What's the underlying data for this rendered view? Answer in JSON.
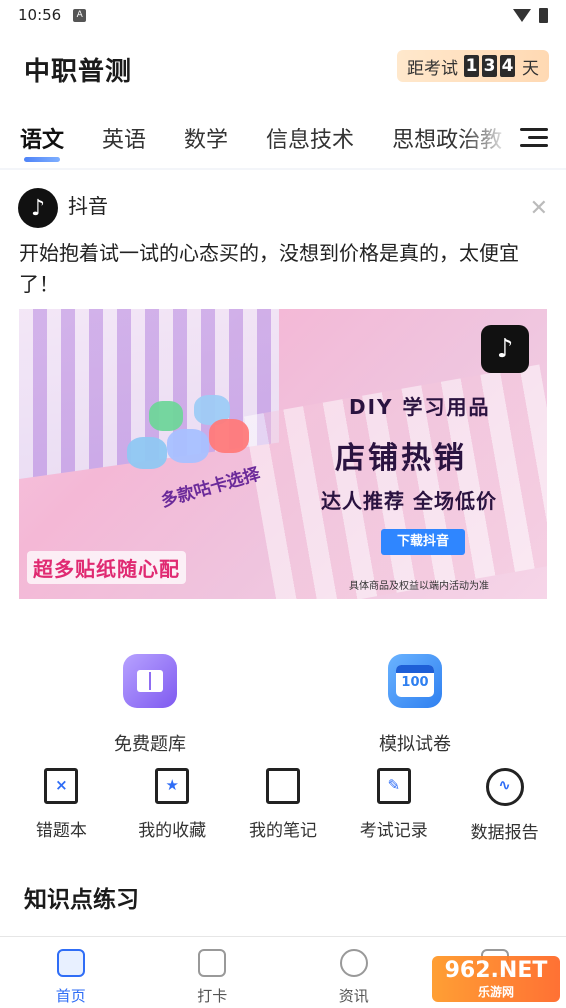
{
  "status": {
    "time": "10:56",
    "indicator": "A"
  },
  "header": {
    "title": "中职普测",
    "countdown": {
      "prefix": "距考试",
      "digits": [
        "1",
        "3",
        "4"
      ],
      "suffix": "天"
    }
  },
  "tabs": [
    {
      "label": "语文",
      "active": true
    },
    {
      "label": "英语"
    },
    {
      "label": "数学"
    },
    {
      "label": "信息技术"
    },
    {
      "label": "思想政治教"
    }
  ],
  "ad": {
    "source": "抖音",
    "text": "开始抱着试一试的心态买的，没想到价格是真的，太便宜了！",
    "image": {
      "line1": "DIY 学习用品",
      "line2": "店铺热销",
      "line3": "达人推荐 全场低价",
      "button": "下载抖音",
      "disclaimer": "具体商品及权益以端内活动为准",
      "sticker_label": "多款咕卡选择",
      "sticker_label2": "超多贴纸随心配"
    }
  },
  "quick_main": [
    {
      "label": "免费题库",
      "icon": "book-icon"
    },
    {
      "label": "模拟试卷",
      "icon": "exam-calendar-icon",
      "badge": "100"
    }
  ],
  "tools": [
    {
      "label": "错题本",
      "icon": "wrong-book-icon",
      "mark": "×"
    },
    {
      "label": "我的收藏",
      "icon": "bookmark-icon",
      "mark": "★"
    },
    {
      "label": "我的笔记",
      "icon": "notebook-icon",
      "mark": ""
    },
    {
      "label": "考试记录",
      "icon": "pen-record-icon",
      "mark": "✎"
    },
    {
      "label": "数据报告",
      "icon": "chart-circle-icon",
      "mark": "∿"
    }
  ],
  "section_title": "知识点练习",
  "bottom_nav": [
    {
      "label": "首页",
      "active": true
    },
    {
      "label": "打卡"
    },
    {
      "label": "资讯"
    },
    {
      "label": ""
    }
  ],
  "watermark": {
    "main": "962.NET",
    "sub": "乐游网"
  },
  "colors": {
    "accent": "#2f6df6",
    "countdown_bg": "#ffd9b3",
    "ad_pink": "#f4b8d6"
  }
}
